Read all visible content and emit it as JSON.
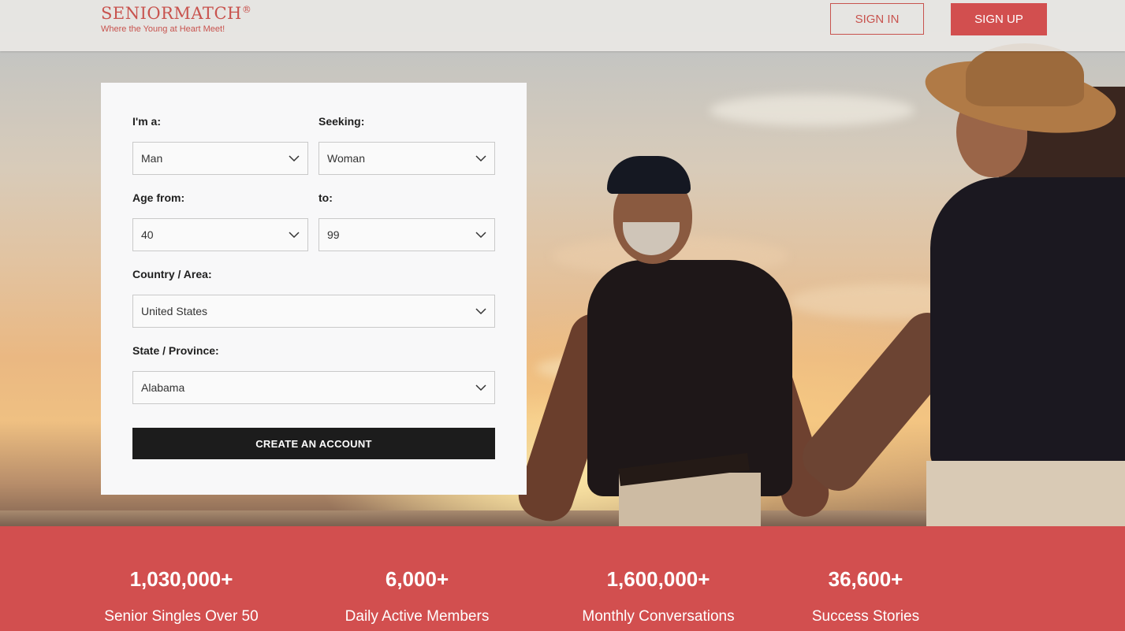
{
  "header": {
    "logo": "SENIORMATCH",
    "logo_mark": "®",
    "tagline": "Where the Young at Heart Meet!",
    "sign_in": "SIGN IN",
    "sign_up": "SIGN UP"
  },
  "form": {
    "im_a_label": "I'm a:",
    "im_a_value": "Man",
    "seeking_label": "Seeking:",
    "seeking_value": "Woman",
    "age_from_label": "Age from:",
    "age_from_value": "40",
    "age_to_label": "to:",
    "age_to_value": "99",
    "country_label": "Country / Area:",
    "country_value": "United States",
    "state_label": "State / Province:",
    "state_value": "Alabama",
    "create_button": "CREATE AN ACCOUNT"
  },
  "stats": [
    {
      "number": "1,030,000+",
      "caption": "Senior Singles Over 50"
    },
    {
      "number": "6,000+",
      "caption": "Daily Active Members"
    },
    {
      "number": "1,600,000+",
      "caption": "Monthly Conversations"
    },
    {
      "number": "36,600+",
      "caption": "Success Stories"
    }
  ],
  "colors": {
    "brand": "#d24f4f",
    "button_dark": "#1c1c1c"
  },
  "icons": {
    "select_arrow": "chevron-down-icon"
  }
}
